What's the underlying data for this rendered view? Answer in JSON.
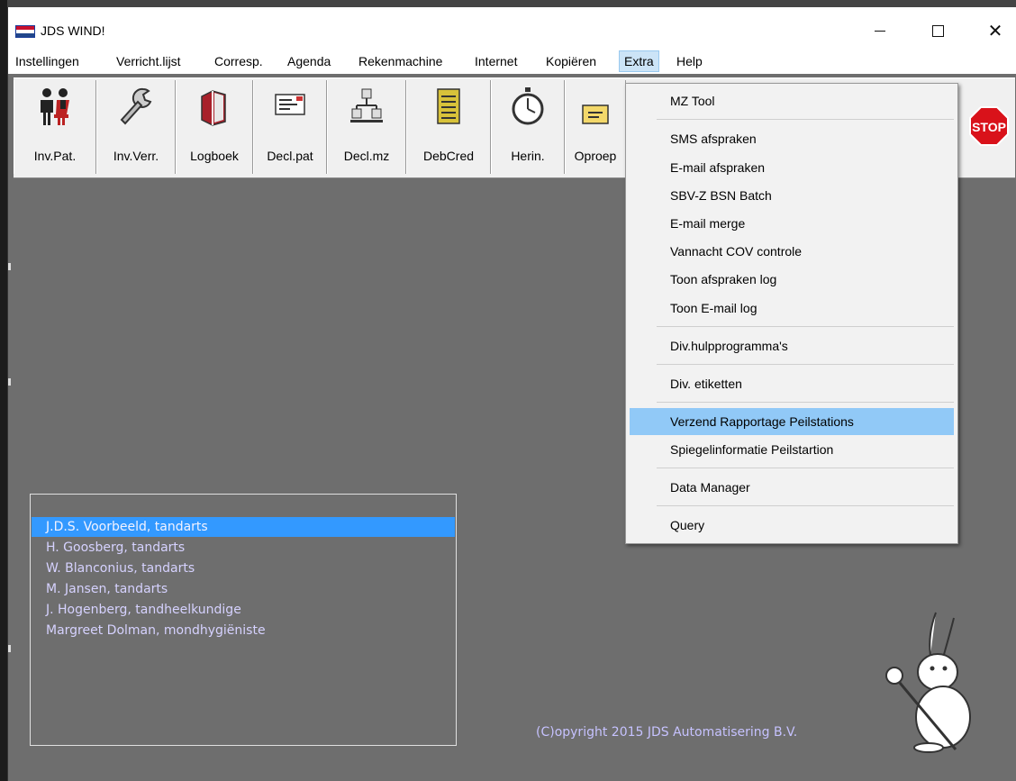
{
  "window": {
    "title": "JDS WIND!",
    "minimize_glyph": "",
    "maximize_glyph": "",
    "close_glyph": "✕"
  },
  "menubar": {
    "items": [
      "Instellingen",
      "Verricht.lijst",
      "Corresp.",
      "Agenda",
      "Rekenmachine",
      "Internet",
      "Kopiëren",
      "Extra",
      "Help"
    ],
    "active": "Extra"
  },
  "toolbar": {
    "buttons": [
      {
        "label": "Inv.Pat.",
        "icon": "patients-icon"
      },
      {
        "label": "Inv.Verr.",
        "icon": "wrench-icon"
      },
      {
        "label": "Logboek",
        "icon": "book-icon"
      },
      {
        "label": "Decl.pat",
        "icon": "declaration-icon"
      },
      {
        "label": "Decl.mz",
        "icon": "network-icon"
      },
      {
        "label": "DebCred",
        "icon": "ledger-icon"
      },
      {
        "label": "Herin.",
        "icon": "stopwatch-icon"
      },
      {
        "label": "Oproep",
        "icon": "envelope-icon"
      }
    ],
    "stop_label": "STOP"
  },
  "extra_menu": {
    "items": [
      "MZ Tool",
      "SMS afspraken",
      "E-mail afspraken",
      "SBV-Z BSN Batch",
      "E-mail merge",
      "Vannacht COV controle",
      "Toon afspraken log",
      "Toon E-mail log",
      "Div.hulpprogramma's",
      "Div. etiketten",
      "Verzend Rapportage Peilstations",
      "Spiegelinformatie Peilstartion",
      "Data Manager",
      "Query"
    ],
    "highlighted": "Verzend Rapportage Peilstations"
  },
  "practitioners": {
    "items": [
      "J.D.S. Voorbeeld, tandarts",
      "H. Goosberg, tandarts",
      "W. Blanconius, tandarts",
      "M. Jansen, tandarts",
      "J. Hogenberg, tandheelkundige",
      "Margreet Dolman, mondhygiëniste"
    ],
    "selected": "J.D.S. Voorbeeld, tandarts"
  },
  "copyright": "(C)opyright 2015 JDS Automatisering B.V.",
  "colors": {
    "workspace": "#6e6e6e",
    "selection": "#3399ff",
    "menu_highlight": "#91c9f7",
    "list_text": "#d6d2ff"
  }
}
